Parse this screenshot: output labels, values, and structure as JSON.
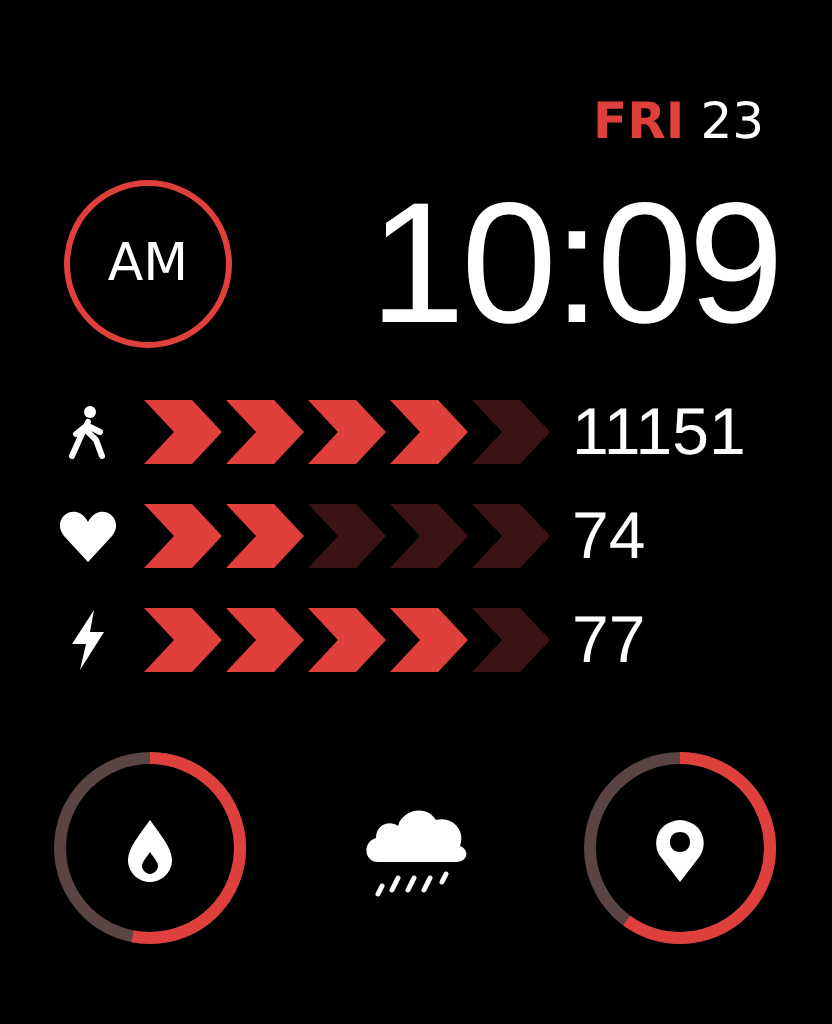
{
  "date": {
    "weekday": "FRI",
    "day": "23"
  },
  "period": "AM",
  "time": "10:09",
  "metrics": [
    {
      "kind": "steps",
      "value": "11151",
      "level": 0.8
    },
    {
      "kind": "heart",
      "value": "74",
      "level": 0.4
    },
    {
      "kind": "energy",
      "value": "77",
      "level": 0.8
    }
  ],
  "complications": [
    {
      "kind": "drop"
    },
    {
      "kind": "weather"
    },
    {
      "kind": "pin"
    }
  ]
}
